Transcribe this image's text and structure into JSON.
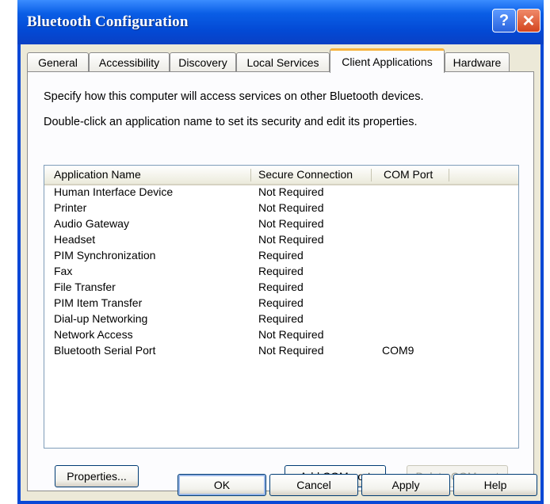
{
  "window": {
    "title": "Bluetooth Configuration",
    "help_glyph": "?",
    "close_glyph": "✕"
  },
  "tabs": [
    {
      "label": "General",
      "active": false
    },
    {
      "label": "Accessibility",
      "active": false
    },
    {
      "label": "Discovery",
      "active": false
    },
    {
      "label": "Local Services",
      "active": false
    },
    {
      "label": "Client Applications",
      "active": true
    },
    {
      "label": "Hardware",
      "active": false
    }
  ],
  "panel": {
    "instruction_1": "Specify how this computer will access services on other Bluetooth devices.",
    "instruction_2": "Double-click an application name to set its security and edit its properties."
  },
  "list": {
    "columns": [
      "Application Name",
      "Secure Connection",
      "COM Port"
    ],
    "rows": [
      {
        "name": "Human Interface Device",
        "secure": "Not Required",
        "com": ""
      },
      {
        "name": "Printer",
        "secure": "Not Required",
        "com": ""
      },
      {
        "name": "Audio Gateway",
        "secure": "Not Required",
        "com": ""
      },
      {
        "name": "Headset",
        "secure": "Not Required",
        "com": ""
      },
      {
        "name": "PIM Synchronization",
        "secure": "Required",
        "com": ""
      },
      {
        "name": "Fax",
        "secure": "Required",
        "com": ""
      },
      {
        "name": "File Transfer",
        "secure": "Required",
        "com": ""
      },
      {
        "name": "PIM Item Transfer",
        "secure": "Required",
        "com": ""
      },
      {
        "name": "Dial-up Networking",
        "secure": "Required",
        "com": ""
      },
      {
        "name": "Network Access",
        "secure": "Not Required",
        "com": ""
      },
      {
        "name": "Bluetooth Serial Port",
        "secure": "Not Required",
        "com": "COM9"
      }
    ]
  },
  "buttons": {
    "properties": "Properties...",
    "add_com": "Add COM port",
    "delete_com": "Delete COM port",
    "ok": "OK",
    "cancel": "Cancel",
    "apply": "Apply",
    "help": "Help"
  }
}
